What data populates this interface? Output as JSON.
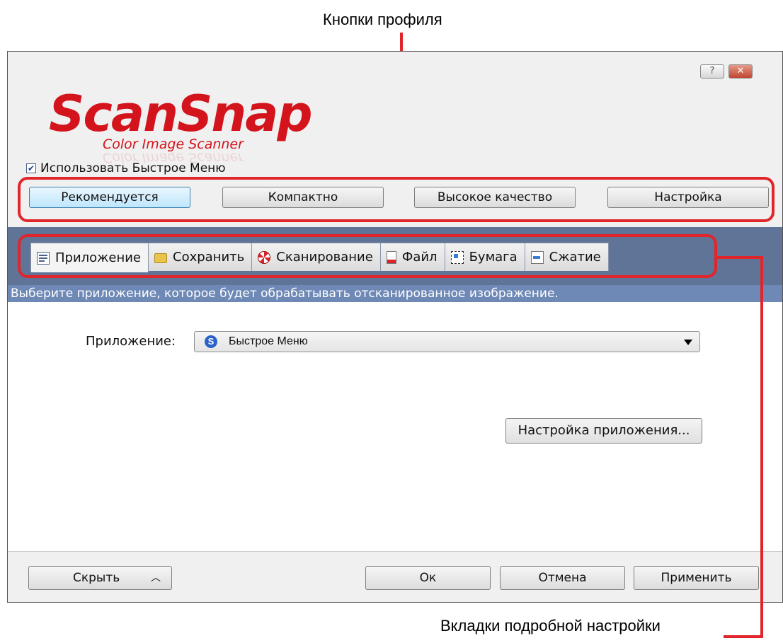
{
  "callouts": {
    "top": "Кнопки профиля",
    "bottom": "Вкладки подробной настройки"
  },
  "window": {
    "help_icon": "?",
    "close_icon": "✕"
  },
  "logo": {
    "main": "ScanSnap",
    "sub": "Color Image Scanner"
  },
  "quick_menu": {
    "checked": true,
    "label": "Использовать Быстрое Меню"
  },
  "profile_buttons": [
    "Рекомендуется",
    "Компактно",
    "Высокое качество",
    "Настройка"
  ],
  "tabs": [
    {
      "label": "Приложение",
      "icon": "application-icon"
    },
    {
      "label": "Сохранить",
      "icon": "folder-icon"
    },
    {
      "label": "Сканирование",
      "icon": "scan-icon"
    },
    {
      "label": "Файл",
      "icon": "file-icon"
    },
    {
      "label": "Бумага",
      "icon": "paper-icon"
    },
    {
      "label": "Сжатие",
      "icon": "compression-icon"
    }
  ],
  "description": "Выберите приложение, которое будет обрабатывать отсканированное изображение.",
  "app": {
    "label": "Приложение:",
    "value": "Быстрое Меню",
    "settings_button": "Настройка приложения..."
  },
  "footer": {
    "hide": "Скрыть",
    "ok": "Ок",
    "cancel": "Отмена",
    "apply": "Применить"
  },
  "colors": {
    "accent_red": "#e0262b",
    "brand_red": "#d4141c",
    "band": "#5f7497",
    "desc_bar": "#6f89b6"
  }
}
